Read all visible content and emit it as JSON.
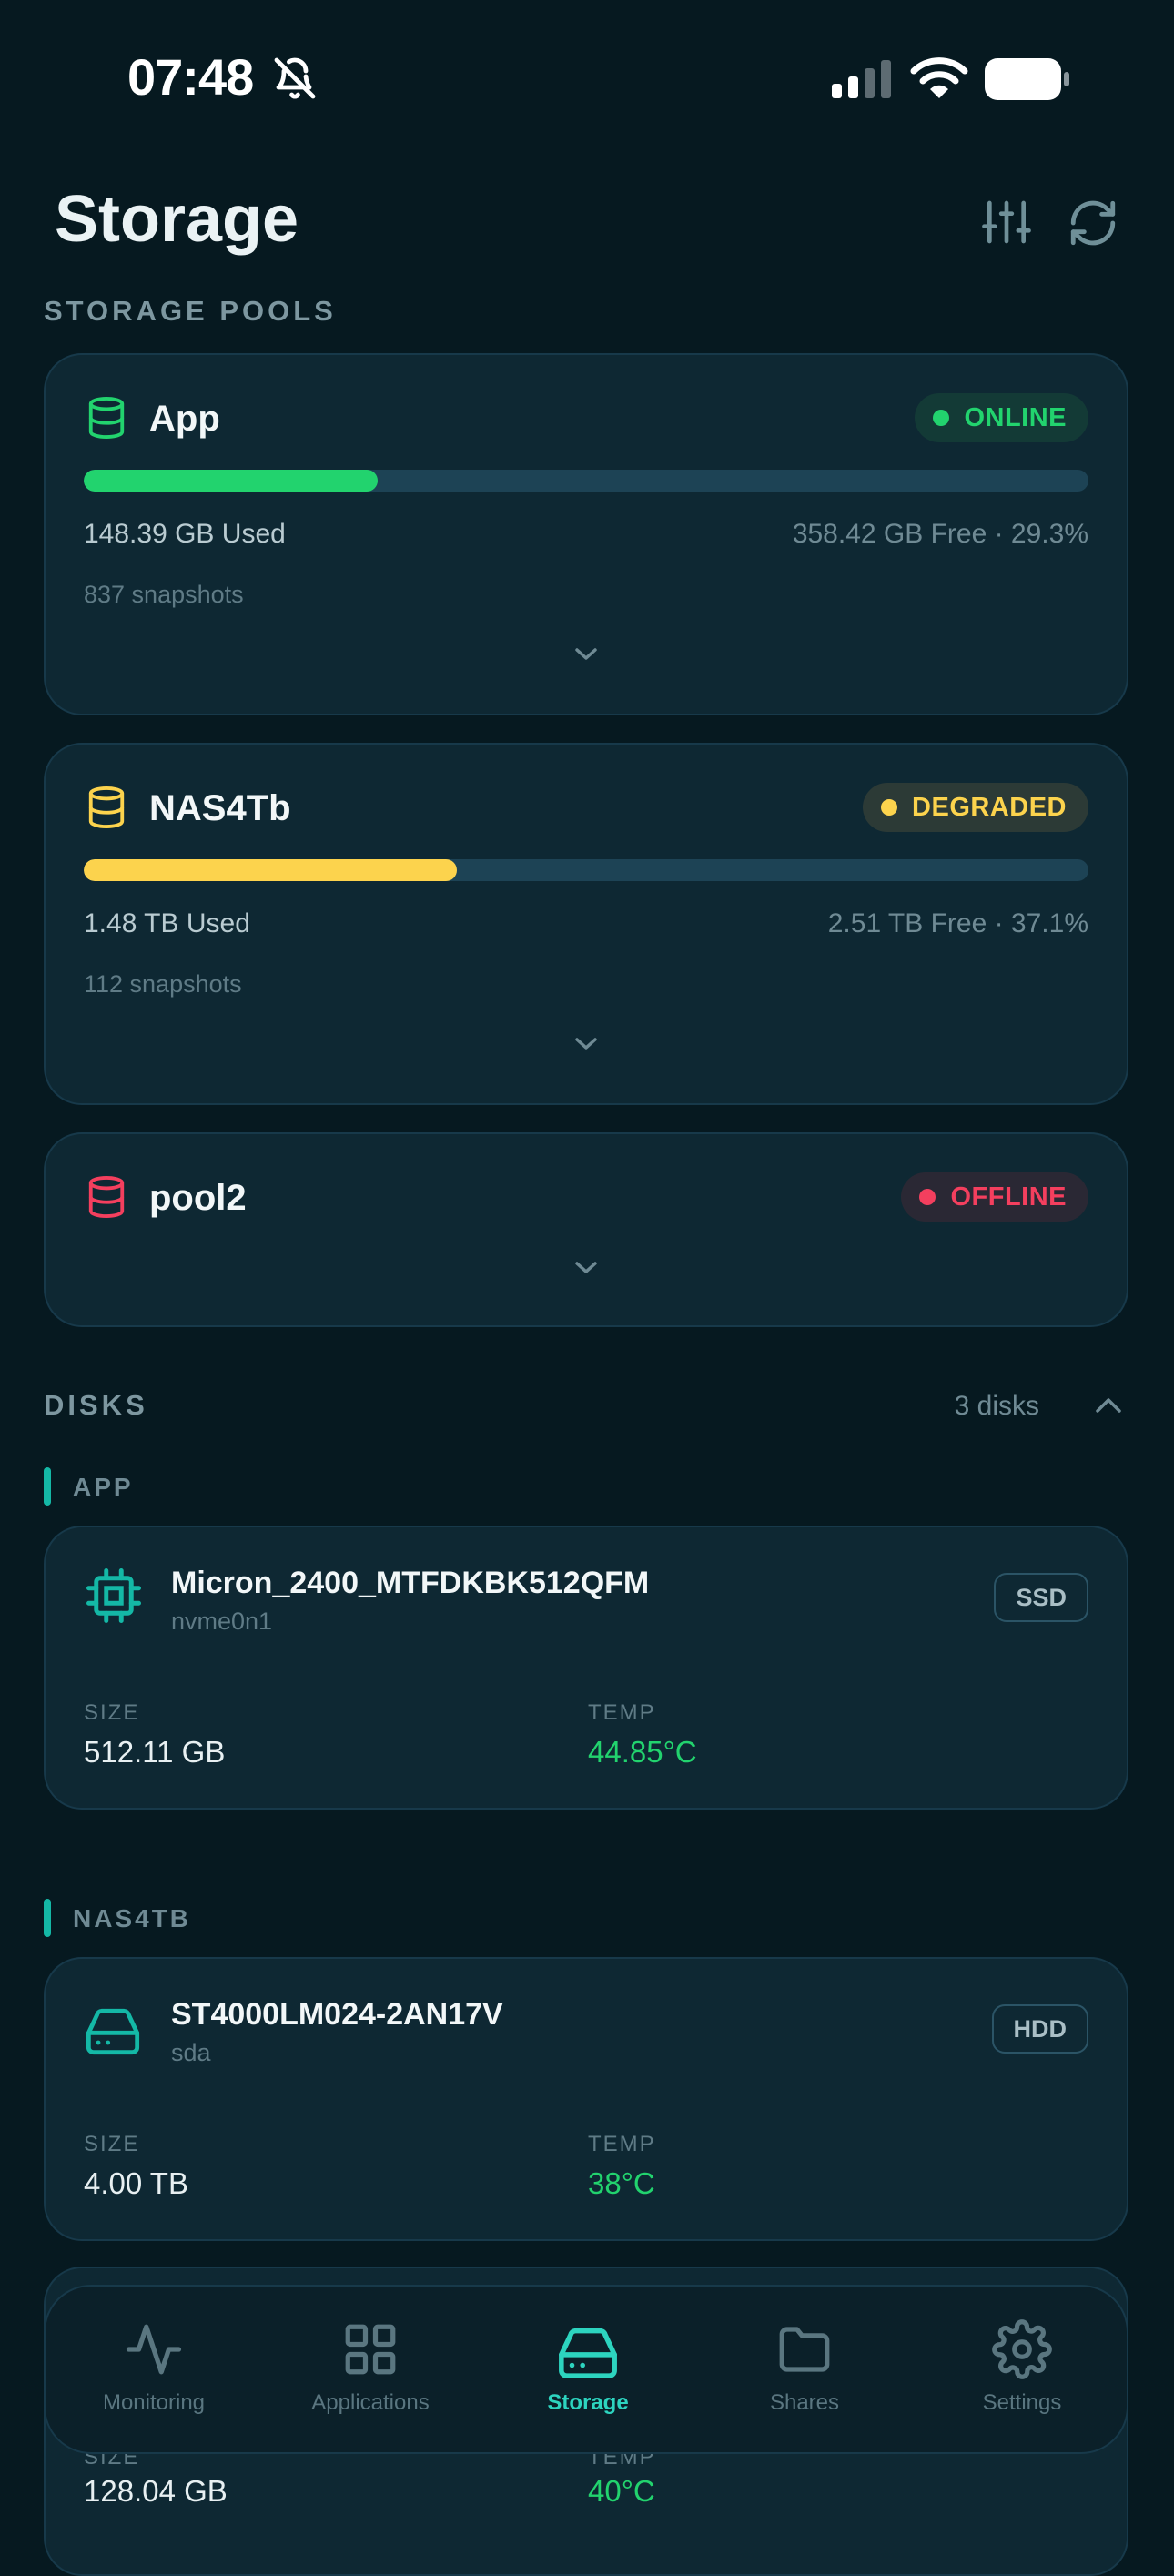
{
  "status_bar": {
    "time": "07:48"
  },
  "header": {
    "title": "Storage"
  },
  "pools_section": {
    "label": "STORAGE POOLS"
  },
  "pools": [
    {
      "name": "App",
      "status": "ONLINE",
      "color": "#22d36e",
      "badge_bg": "#133a36",
      "usage_fraction": 0.293,
      "used": "148.39 GB Used",
      "free": "358.42 GB Free · 29.3%",
      "snapshots": "837 snapshots"
    },
    {
      "name": "NAS4Tb",
      "status": "DEGRADED",
      "color": "#fcd34d",
      "badge_bg": "#2c3a36",
      "usage_fraction": 0.371,
      "used": "1.48 TB Used",
      "free": "2.51 TB Free · 37.1%",
      "snapshots": "112 snapshots"
    },
    {
      "name": "pool2",
      "status": "OFFLINE",
      "color": "#f43f5e",
      "badge_bg": "#2a2834"
    }
  ],
  "disks_section": {
    "label": "DISKS",
    "count": "3 disks"
  },
  "disk_groups": [
    {
      "label": "APP",
      "disk": {
        "name": "Micron_2400_MTFDKBK512QFM",
        "device": "nvme0n1",
        "type": "SSD",
        "icon": "chip-icon",
        "size_label": "SIZE",
        "size": "512.11 GB",
        "temp_label": "TEMP",
        "temp": "44.85°C"
      }
    },
    {
      "label": "NAS4TB",
      "disk": {
        "name": "ST4000LM024-2AN17V",
        "device": "sda",
        "type": "HDD",
        "icon": "hard-drive-icon",
        "size_label": "SIZE",
        "size": "4.00 TB",
        "temp_label": "TEMP",
        "temp": "38°C"
      }
    }
  ],
  "partial_disk": {
    "size_label": "SIZE",
    "size": "128.04 GB",
    "temp_label": "TEMP",
    "temp": "40°C"
  },
  "nav": [
    {
      "label": "Monitoring",
      "icon": "activity-icon"
    },
    {
      "label": "Applications",
      "icon": "grid-icon"
    },
    {
      "label": "Storage",
      "icon": "hard-drive-icon",
      "active": true
    },
    {
      "label": "Shares",
      "icon": "folder-icon"
    },
    {
      "label": "Settings",
      "icon": "gear-icon"
    }
  ],
  "colors": {
    "accent": "#2dd4bf",
    "background": "#061920",
    "card": "#0e2833"
  }
}
